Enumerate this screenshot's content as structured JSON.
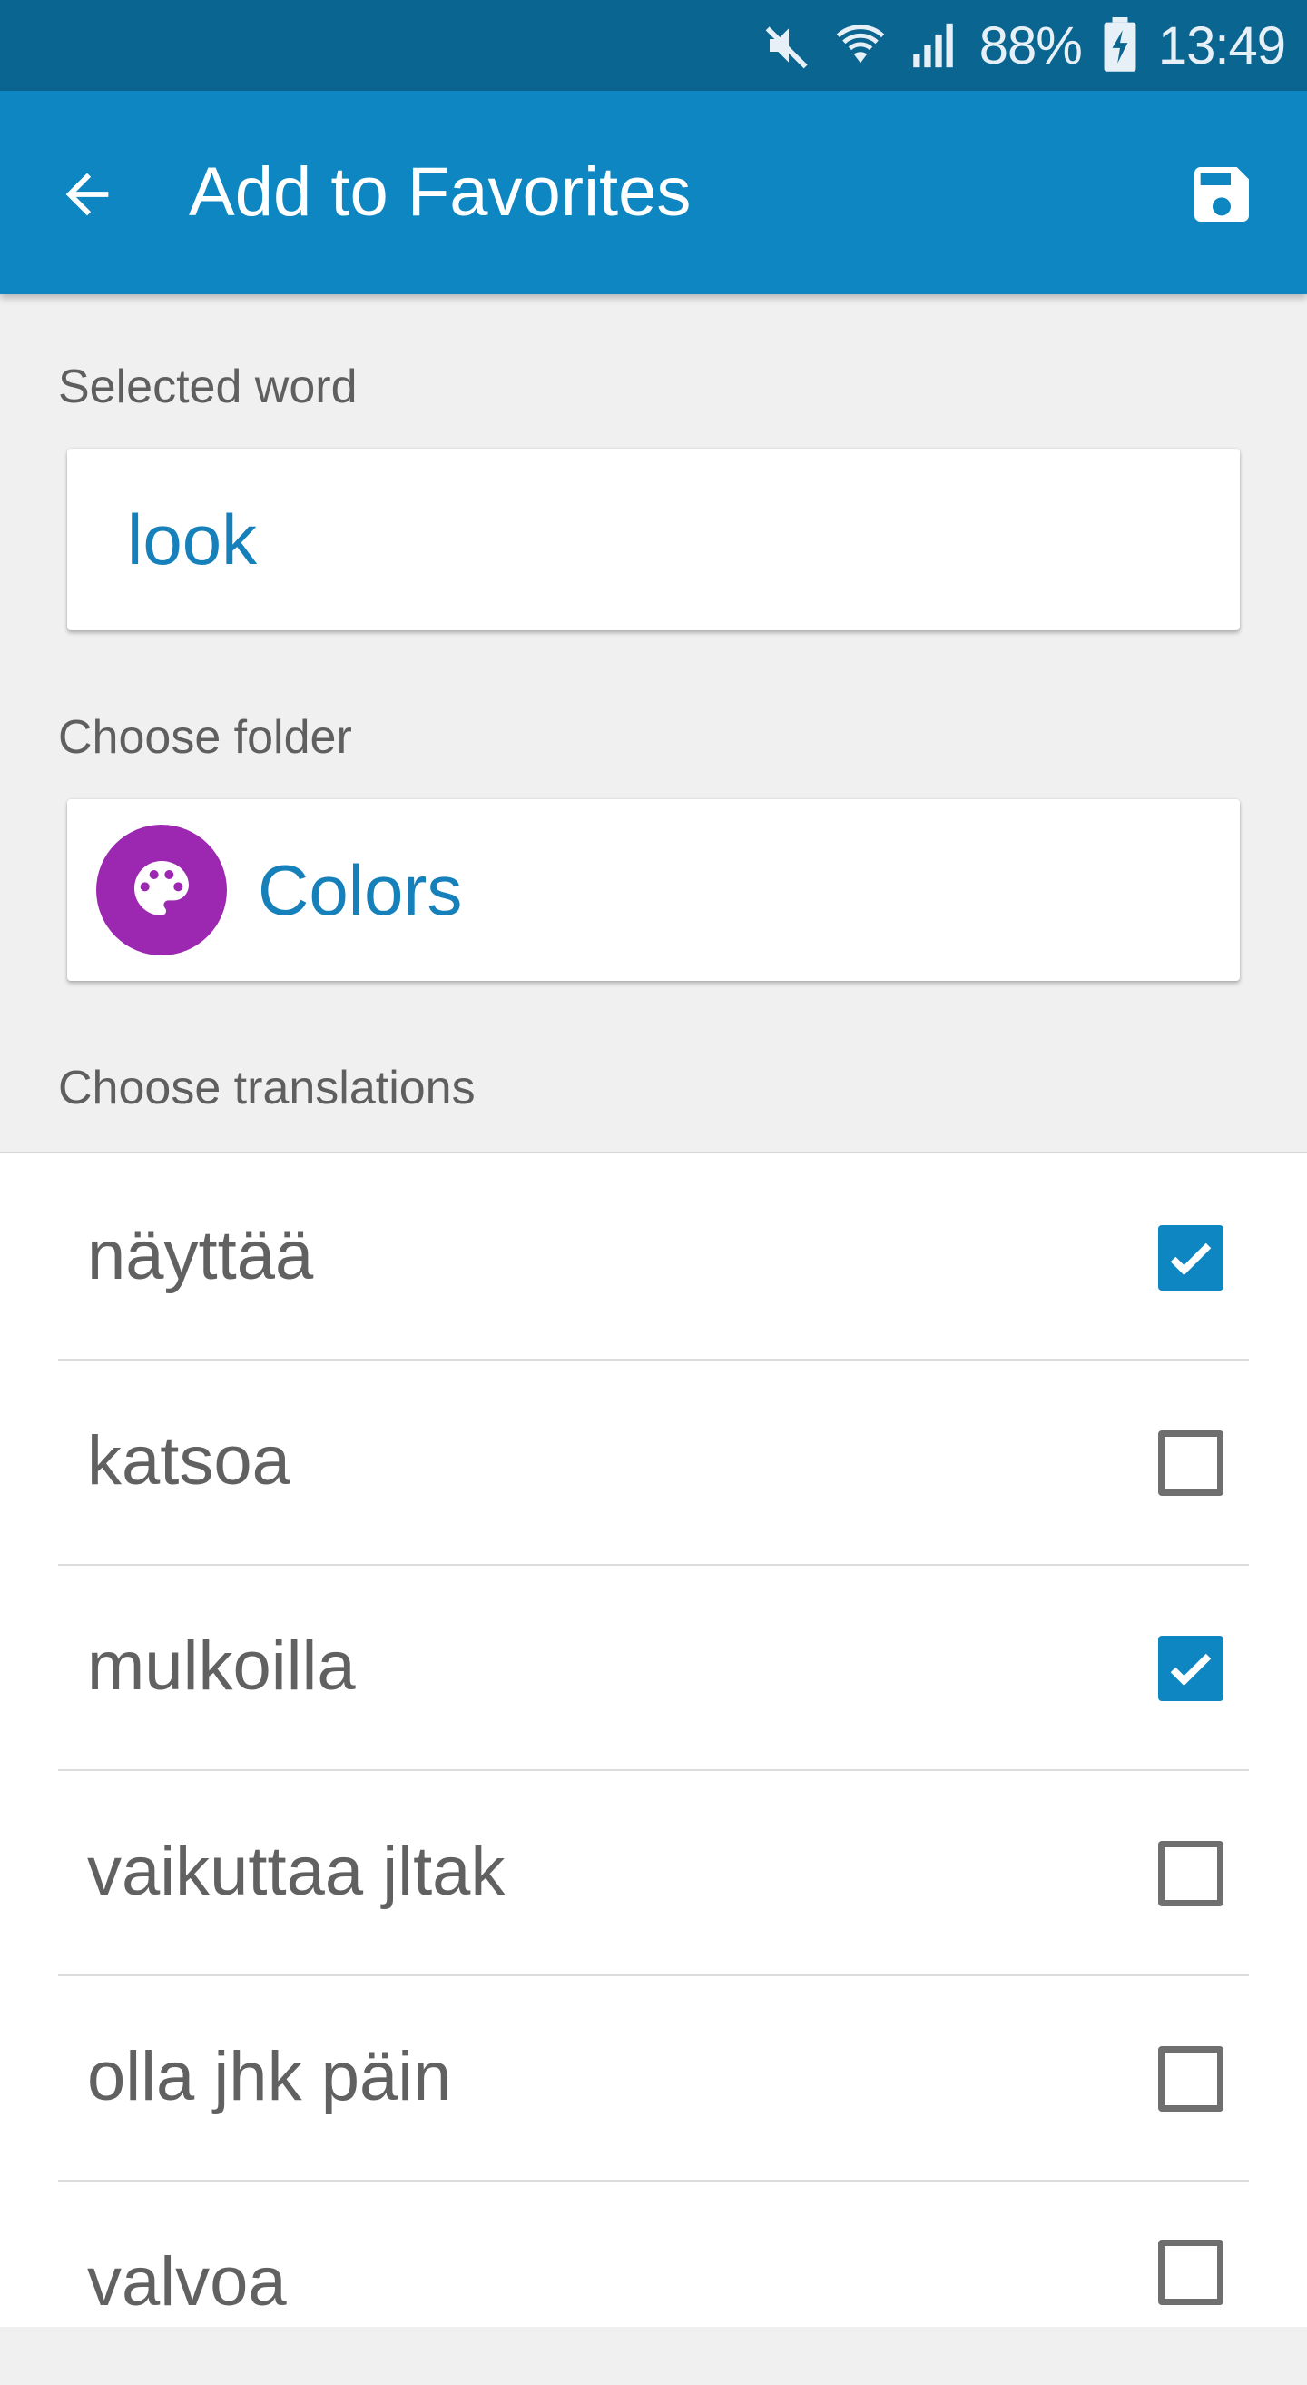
{
  "status_bar": {
    "battery": "88%",
    "time": "13:49",
    "icons": [
      "mute-icon",
      "wifi-icon",
      "signal-icon",
      "battery-charging-icon"
    ]
  },
  "app_bar": {
    "title": "Add to Favorites",
    "back_icon": "arrow-back-icon",
    "save_icon": "save-icon"
  },
  "selected_word": {
    "label": "Selected word",
    "value": "look"
  },
  "folder": {
    "label": "Choose folder",
    "name": "Colors",
    "icon": "palette-icon",
    "color": "#9c27b0"
  },
  "translations": {
    "label": "Choose translations",
    "items": [
      {
        "text": "näyttää",
        "checked": true
      },
      {
        "text": "katsoa",
        "checked": false
      },
      {
        "text": "mulkoilla",
        "checked": true
      },
      {
        "text": "vaikuttaa jltak",
        "checked": false
      },
      {
        "text": "olla jhk päin",
        "checked": false
      },
      {
        "text": "valvoa",
        "checked": false
      }
    ]
  },
  "colors": {
    "status_bar": "#0b6591",
    "app_bar": "#0d86c2",
    "accent": "#1580ba"
  }
}
